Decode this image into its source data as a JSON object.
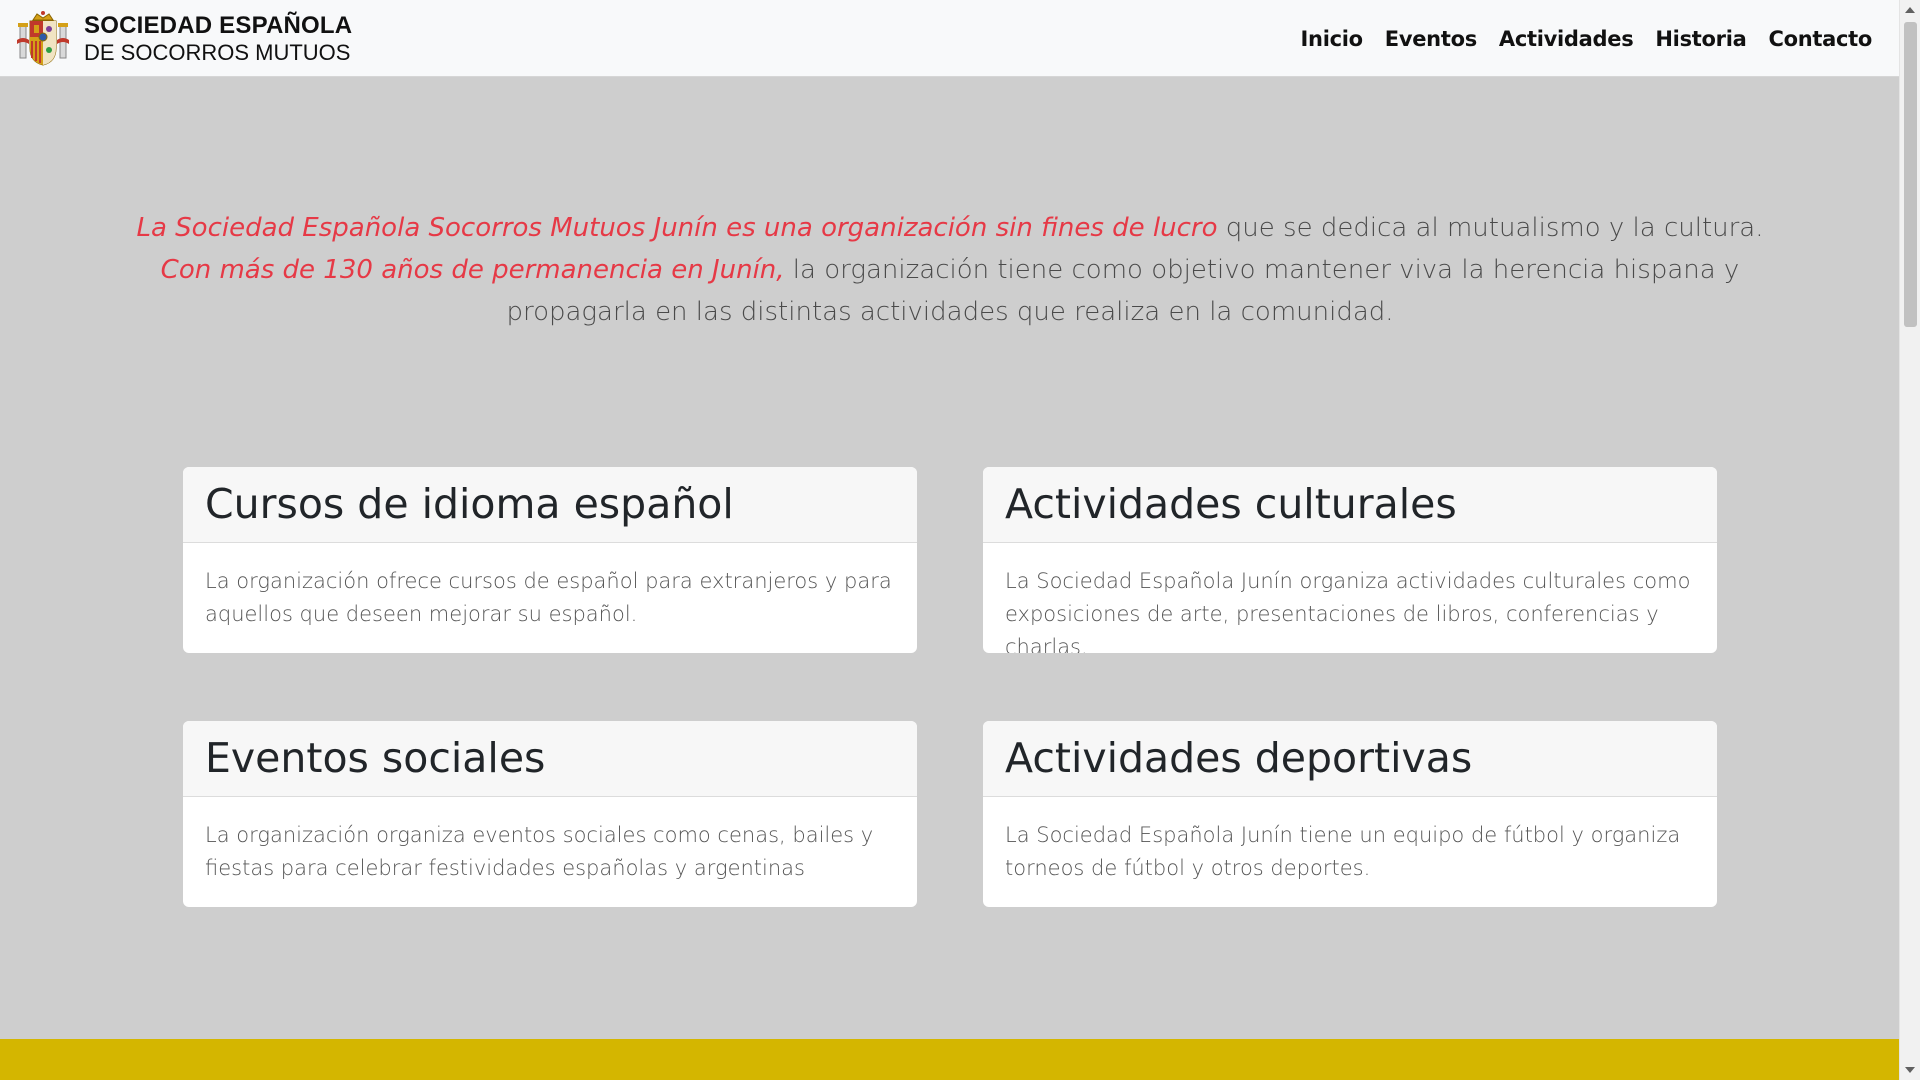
{
  "header": {
    "brand_line1": "SOCIEDAD ESPAÑOLA",
    "brand_line2": "DE SOCORROS MUTUOS",
    "logo_icon": "coat-of-arms-icon",
    "nav": [
      {
        "label": "Inicio"
      },
      {
        "label": "Eventos"
      },
      {
        "label": "Actividades"
      },
      {
        "label": "Historia"
      },
      {
        "label": "Contacto"
      }
    ]
  },
  "intro": {
    "highlight1": "La Sociedad Española Socorros Mutuos Junín es una organización sin fines de lucro",
    "text1": " que se dedica al mutualismo y la cultura.",
    "highlight2": "Con más de 130 años de permanencia en Junín,",
    "text2": " la organización tiene como objetivo mantener viva la herencia hispana y propagarla en las distintas actividades que realiza en la comunidad."
  },
  "cards": [
    {
      "title": "Cursos de idioma español",
      "body": "La organización ofrece cursos de español para extranjeros y para aquellos que deseen mejorar su español."
    },
    {
      "title": "Actividades culturales",
      "body": "La Sociedad Española Junín organiza actividades culturales como exposiciones de arte, presentaciones de libros, conferencias y charlas."
    },
    {
      "title": "Eventos sociales",
      "body": "La organización organiza eventos sociales como cenas, bailes y fiestas para celebrar festividades españolas y argentinas"
    },
    {
      "title": "Actividades deportivas",
      "body": "La Sociedad Española Junín tiene un equipo de fútbol y organiza torneos de fútbol y otros deportes."
    }
  ],
  "colors": {
    "highlight": "#e63946",
    "background": "#cecece",
    "footer_band": "#d4b600",
    "navbar": "#f8f9fa"
  }
}
